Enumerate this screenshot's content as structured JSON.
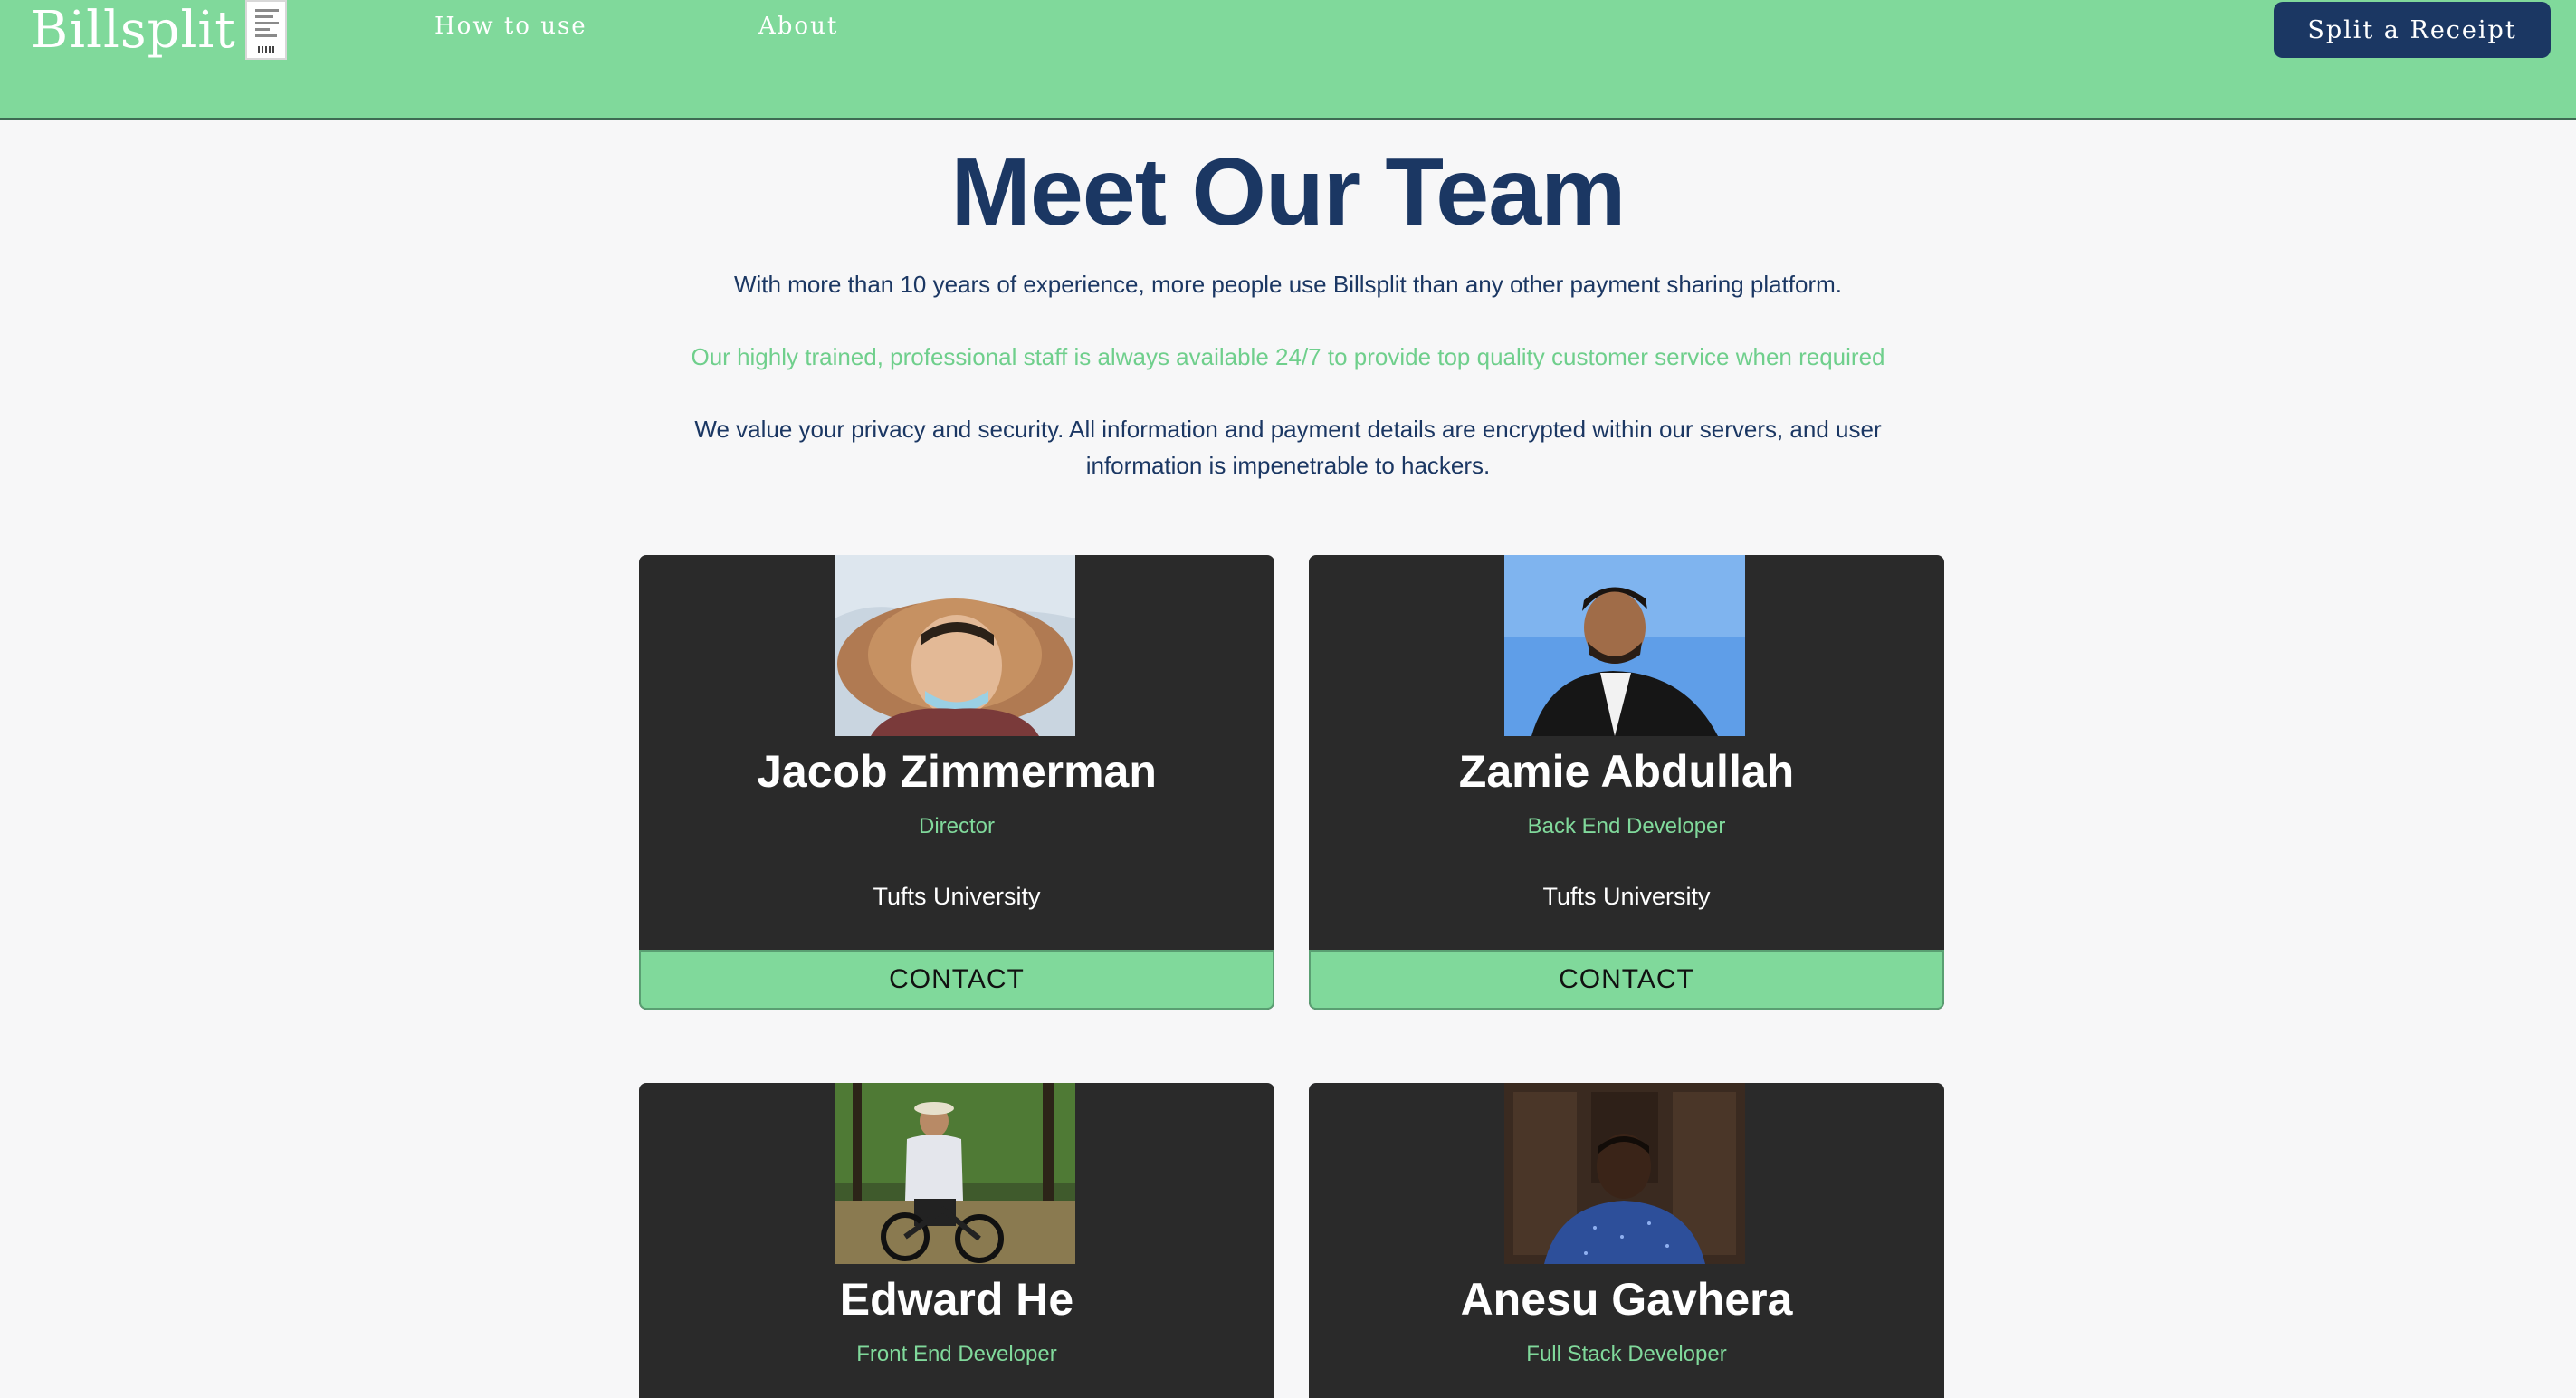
{
  "navbar": {
    "brand": "Billsplit",
    "links": [
      "How to use",
      "About"
    ],
    "cta": "Split a Receipt",
    "bg_color": "#80d99b"
  },
  "hero": {
    "title": "Meet Our Team",
    "paragraphs": [
      "With more than 10 years of experience, more people use Billsplit than any other payment sharing platform.",
      "Our highly trained, professional staff is always available 24/7 to provide top quality customer service when required",
      "We value your privacy and security. All information and payment details are encrypted within our servers, and user information is impenetrable to hackers."
    ]
  },
  "team": [
    {
      "name": "Jacob Zimmerman",
      "role": "Director",
      "school": "Tufts University",
      "contact": "CONTACT"
    },
    {
      "name": "Zamie Abdullah",
      "role": "Back End Developer",
      "school": "Tufts University",
      "contact": "CONTACT"
    },
    {
      "name": "Edward He",
      "role": "Front End Developer"
    },
    {
      "name": "Anesu Gavhera",
      "role": "Full Stack Developer"
    }
  ],
  "colors": {
    "accent": "#80d99b",
    "navy": "#1b3763",
    "card": "#2a2a2a",
    "page": "#f7f7f8"
  }
}
